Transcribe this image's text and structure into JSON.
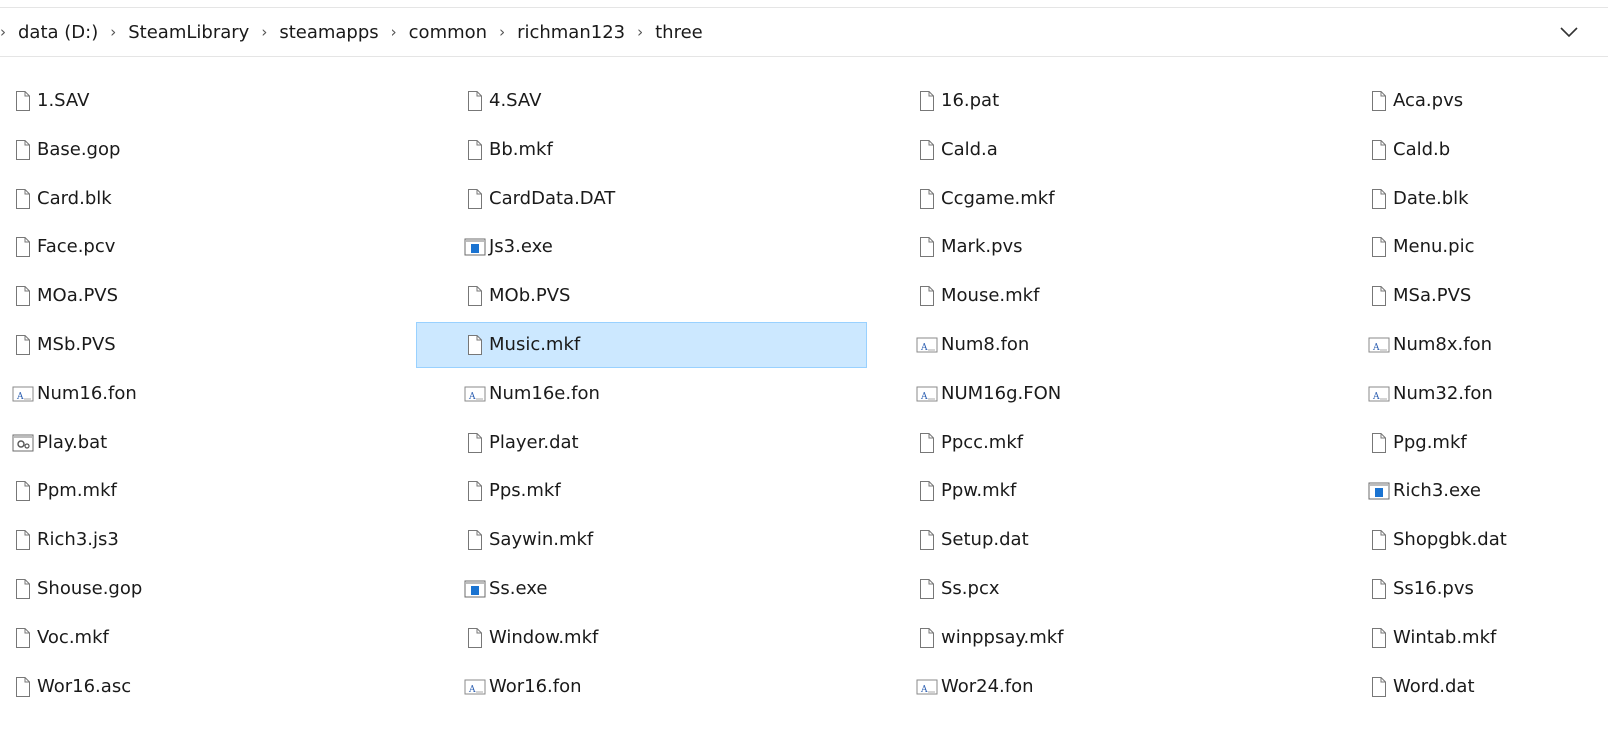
{
  "breadcrumb": [
    "data (D:)",
    "SteamLibrary",
    "steamapps",
    "common",
    "richman123",
    "three"
  ],
  "files": [
    {
      "name": "1.SAV",
      "icon": "file-icon"
    },
    {
      "name": "4.SAV",
      "icon": "file-icon"
    },
    {
      "name": "16.pat",
      "icon": "file-icon"
    },
    {
      "name": "Aca.pvs",
      "icon": "file-icon"
    },
    {
      "name": "Base.gop",
      "icon": "file-icon"
    },
    {
      "name": "Bb.mkf",
      "icon": "file-icon"
    },
    {
      "name": "Cald.a",
      "icon": "file-icon"
    },
    {
      "name": "Cald.b",
      "icon": "file-icon"
    },
    {
      "name": "Card.blk",
      "icon": "file-icon"
    },
    {
      "name": "CardData.DAT",
      "icon": "file-icon"
    },
    {
      "name": "Ccgame.mkf",
      "icon": "file-icon"
    },
    {
      "name": "Date.blk",
      "icon": "file-icon"
    },
    {
      "name": "Face.pcv",
      "icon": "file-icon"
    },
    {
      "name": "Js3.exe",
      "icon": "exe-icon"
    },
    {
      "name": "Mark.pvs",
      "icon": "file-icon"
    },
    {
      "name": "Menu.pic",
      "icon": "file-icon"
    },
    {
      "name": "MOa.PVS",
      "icon": "file-icon"
    },
    {
      "name": "MOb.PVS",
      "icon": "file-icon"
    },
    {
      "name": "Mouse.mkf",
      "icon": "file-icon"
    },
    {
      "name": "MSa.PVS",
      "icon": "file-icon"
    },
    {
      "name": "MSb.PVS",
      "icon": "file-icon"
    },
    {
      "name": "Music.mkf",
      "icon": "file-icon",
      "selected": true
    },
    {
      "name": "Num8.fon",
      "icon": "font-icon"
    },
    {
      "name": "Num8x.fon",
      "icon": "font-icon"
    },
    {
      "name": "Num16.fon",
      "icon": "font-icon"
    },
    {
      "name": "Num16e.fon",
      "icon": "font-icon"
    },
    {
      "name": "NUM16g.FON",
      "icon": "font-icon"
    },
    {
      "name": "Num32.fon",
      "icon": "font-icon"
    },
    {
      "name": "Play.bat",
      "icon": "batch-icon"
    },
    {
      "name": "Player.dat",
      "icon": "file-icon"
    },
    {
      "name": "Ppcc.mkf",
      "icon": "file-icon"
    },
    {
      "name": "Ppg.mkf",
      "icon": "file-icon"
    },
    {
      "name": "Ppm.mkf",
      "icon": "file-icon"
    },
    {
      "name": "Pps.mkf",
      "icon": "file-icon"
    },
    {
      "name": "Ppw.mkf",
      "icon": "file-icon"
    },
    {
      "name": "Rich3.exe",
      "icon": "exe-icon"
    },
    {
      "name": "Rich3.js3",
      "icon": "file-icon"
    },
    {
      "name": "Saywin.mkf",
      "icon": "file-icon"
    },
    {
      "name": "Setup.dat",
      "icon": "file-icon"
    },
    {
      "name": "Shopgbk.dat",
      "icon": "file-icon"
    },
    {
      "name": "Shouse.gop",
      "icon": "file-icon"
    },
    {
      "name": "Ss.exe",
      "icon": "exe-icon"
    },
    {
      "name": "Ss.pcx",
      "icon": "file-icon"
    },
    {
      "name": "Ss16.pvs",
      "icon": "file-icon"
    },
    {
      "name": "Voc.mkf",
      "icon": "file-icon"
    },
    {
      "name": "Window.mkf",
      "icon": "file-icon"
    },
    {
      "name": "winppsay.mkf",
      "icon": "file-icon"
    },
    {
      "name": "Wintab.mkf",
      "icon": "file-icon"
    },
    {
      "name": "Wor16.asc",
      "icon": "file-icon"
    },
    {
      "name": "Wor16.fon",
      "icon": "font-icon"
    },
    {
      "name": "Wor24.fon",
      "icon": "font-icon"
    },
    {
      "name": "Word.dat",
      "icon": "file-icon"
    }
  ],
  "colors": {
    "selection_bg": "#cce8ff",
    "selection_border": "#99d1ff",
    "exe_blue": "#1a73d1",
    "font_blue": "#2a5db0"
  }
}
